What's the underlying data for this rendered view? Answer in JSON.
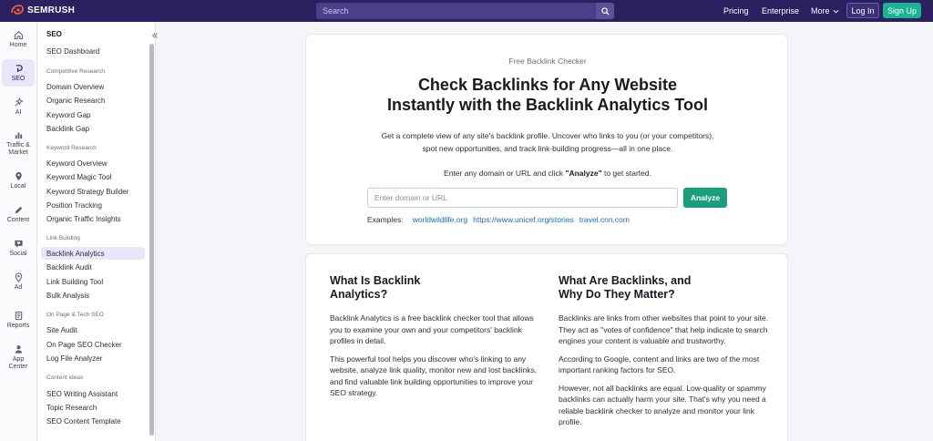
{
  "brand": {
    "name": "SEMRUSH",
    "accent": "#2b2160",
    "green": "#1ab394"
  },
  "topbar": {
    "search_placeholder": "Search",
    "pricing": "Pricing",
    "enterprise": "Enterprise",
    "more": "More",
    "login": "Log In",
    "signup": "Sign Up"
  },
  "rail": [
    {
      "label": "Home",
      "icon": "home-icon"
    },
    {
      "label": "SEO",
      "icon": "seo-icon",
      "active": true
    },
    {
      "label": "AI",
      "icon": "ai-sparkle-icon"
    },
    {
      "label": "Traffic & Market",
      "icon": "bar-chart-icon"
    },
    {
      "label": "Local",
      "icon": "map-pin-icon"
    },
    {
      "label": "Content",
      "icon": "pencil-icon"
    },
    {
      "label": "Social",
      "icon": "heart-chat-icon"
    },
    {
      "label": "Ad",
      "icon": "ad-icon"
    },
    {
      "label": "Reports",
      "icon": "report-icon"
    },
    {
      "label": "App Center",
      "icon": "apps-icon"
    }
  ],
  "sidebar": {
    "title": "SEO",
    "dashboard": "SEO Dashboard",
    "groups": [
      {
        "label": "Competitive Research",
        "items": [
          "Domain Overview",
          "Organic Research",
          "Keyword Gap",
          "Backlink Gap"
        ]
      },
      {
        "label": "Keyword Research",
        "items": [
          "Keyword Overview",
          "Keyword Magic Tool",
          "Keyword Strategy Builder",
          "Position Tracking",
          "Organic Traffic Insights"
        ]
      },
      {
        "label": "Link Building",
        "items": [
          "Backlink Analytics",
          "Backlink Audit",
          "Link Building Tool",
          "Bulk Analysis"
        ]
      },
      {
        "label": "On Page & Tech SEO",
        "items": [
          "Site Audit",
          "On Page SEO Checker",
          "Log File Analyzer"
        ]
      },
      {
        "label": "Content ideas",
        "items": [
          "SEO Writing Assistant",
          "Topic Research",
          "SEO Content Template"
        ]
      }
    ]
  },
  "hero": {
    "eyebrow": "Free Backlink Checker",
    "headline_line1": "Check Backlinks for Any Website",
    "headline_line2": "Instantly with the Backlink Analytics Tool",
    "lead": "Get a complete view of any site's backlink profile. Uncover who links to you (or your competitors), spot new opportunities, and track link-building progress—all in one place.",
    "prompt_before": "Enter any domain or URL and click ",
    "prompt_bold": "\"Analyze\"",
    "prompt_after": " to get started.",
    "input_placeholder": "Enter domain or URL",
    "analyze": "Analyze",
    "examples_label": "Examples:",
    "examples": [
      "worldwildlife.org",
      "https://www.unicef.org/stories",
      "travel.cnn.com"
    ]
  },
  "info": {
    "left": {
      "title_line1": "What Is Backlink",
      "title_line2": "Analytics?",
      "p1": "Backlink Analytics is a free backlink checker tool that allows you to examine your own and your competitors' backlink profiles in detail.",
      "p2": "This powerful tool helps you discover who's linking to any website, analyze link quality, monitor new and lost backlinks, and find valuable link building opportunities to improve your SEO strategy."
    },
    "right": {
      "title_line1": "What Are Backlinks, and",
      "title_line2": "Why Do They Matter?",
      "p1": "Backlinks are links from other websites that point to your site. They act as \"votes of confidence\" that help indicate to search engines your content is valuable and trustworthy.",
      "p2": "According to Google, content and links are two of the most important ranking factors for SEO.",
      "p3": "However, not all backlinks are equal. Low-quality or spammy backlinks can actually harm your site. That's why you need a reliable backlink checker to analyze and monitor your link profile."
    }
  }
}
